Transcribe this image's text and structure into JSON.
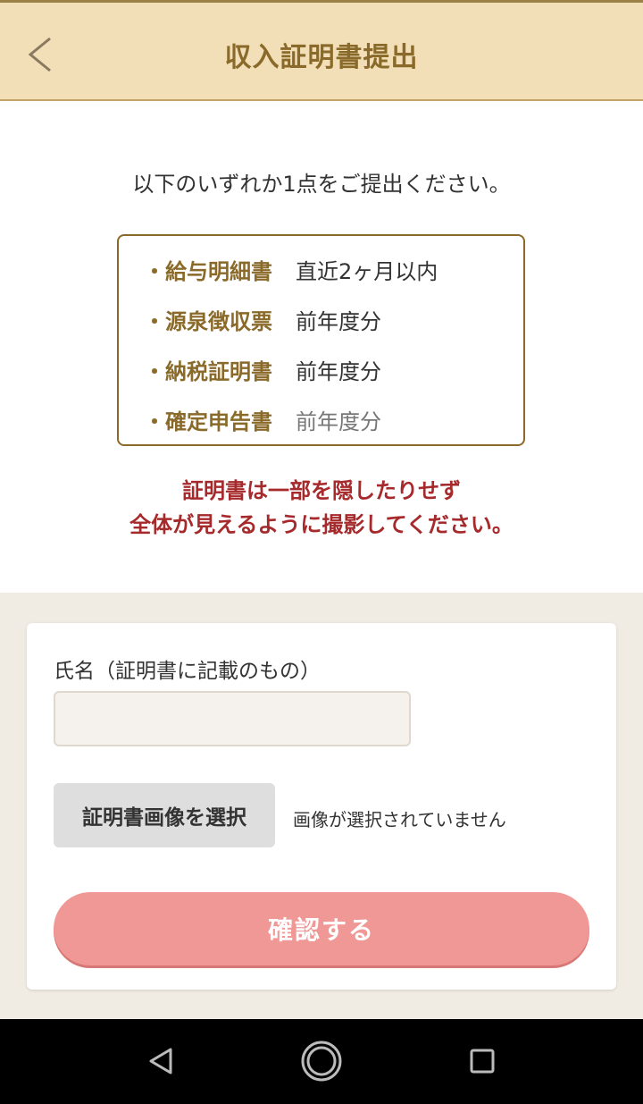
{
  "header": {
    "title": "収入証明書提出",
    "back_icon": "chevron-left-icon"
  },
  "intro": "以下のいずれか1点をご提出ください。",
  "documents": [
    {
      "name": "・給与明細書",
      "period": "直近2ヶ月以内"
    },
    {
      "name": "・源泉徴収票",
      "period": "前年度分"
    },
    {
      "name": "・納税証明書",
      "period": "前年度分"
    },
    {
      "name": "・確定申告書",
      "period": "前年度分"
    }
  ],
  "warning": {
    "line1": "証明書は一部を隠したりせず",
    "line2": "全体が見えるように撮影してください。"
  },
  "form": {
    "name_label": "氏名（証明書に記載のもの）",
    "name_value": "",
    "select_button": "証明書画像を選択",
    "no_image_text": "画像が選択されていません",
    "confirm_button": "確認する"
  },
  "colors": {
    "accent": "#8a6a2a",
    "header_bg": "#f2dfb8",
    "warning": "#a6292b",
    "confirm": "#f09896"
  },
  "navbar": {
    "icons": [
      "back-triangle-icon",
      "home-circle-icon",
      "recents-square-icon"
    ]
  }
}
